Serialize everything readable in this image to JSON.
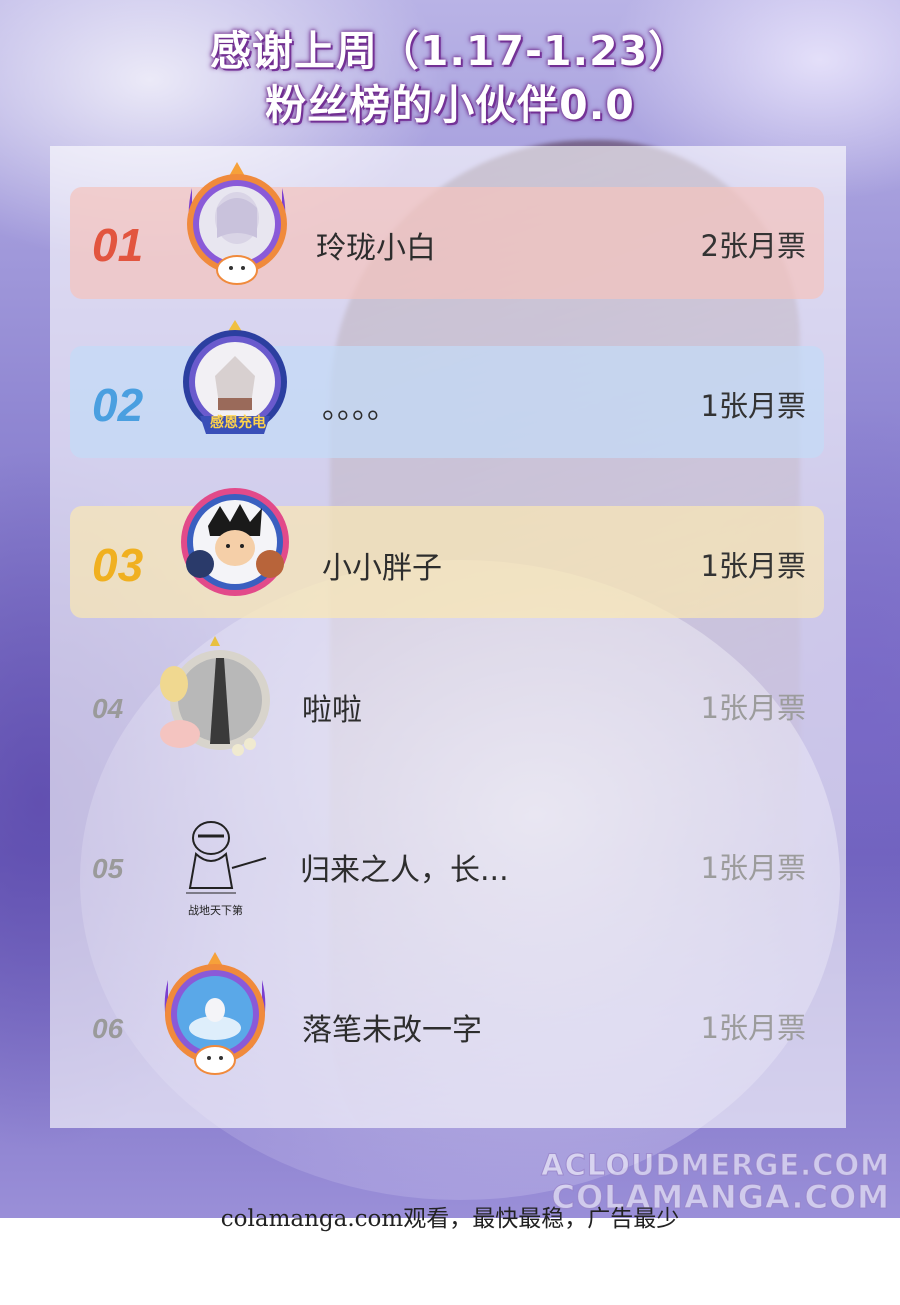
{
  "title": {
    "line1": "感谢上周（1.17-1.23）",
    "line2": "粉丝榜的小伙伴0.0"
  },
  "fans": [
    {
      "rank": "01",
      "name": "玲珑小白",
      "votes": "2张月票",
      "rank_color": "#e2553f",
      "frame": "purple-badge"
    },
    {
      "rank": "02",
      "name": "。。。。",
      "votes": "1张月票",
      "rank_color": "#4a9fe0",
      "frame": "blue-badge",
      "badge_text": "感恩充电"
    },
    {
      "rank": "03",
      "name": "小小胖子",
      "votes": "1张月票",
      "rank_color": "#f0b020",
      "frame": "ring-badge"
    },
    {
      "rank": "04",
      "name": "啦啦",
      "votes": "1张月票",
      "rank_color": "#9a9a9a",
      "frame": "arch-badge"
    },
    {
      "rank": "05",
      "name": "归来之人，长...",
      "votes": "1张月票",
      "rank_color": "#9a9a9a",
      "frame": "sketch",
      "avatar_caption": "战地天下第"
    },
    {
      "rank": "06",
      "name": "落笔未改一字",
      "votes": "1张月票",
      "rank_color": "#9a9a9a",
      "frame": "purple-badge"
    }
  ],
  "watermark": {
    "line1": "ACLOUDMERGE.COM",
    "line2": "COLAMANGA.COM"
  },
  "footer": "colamanga.com观看，最快最稳，广告最少"
}
